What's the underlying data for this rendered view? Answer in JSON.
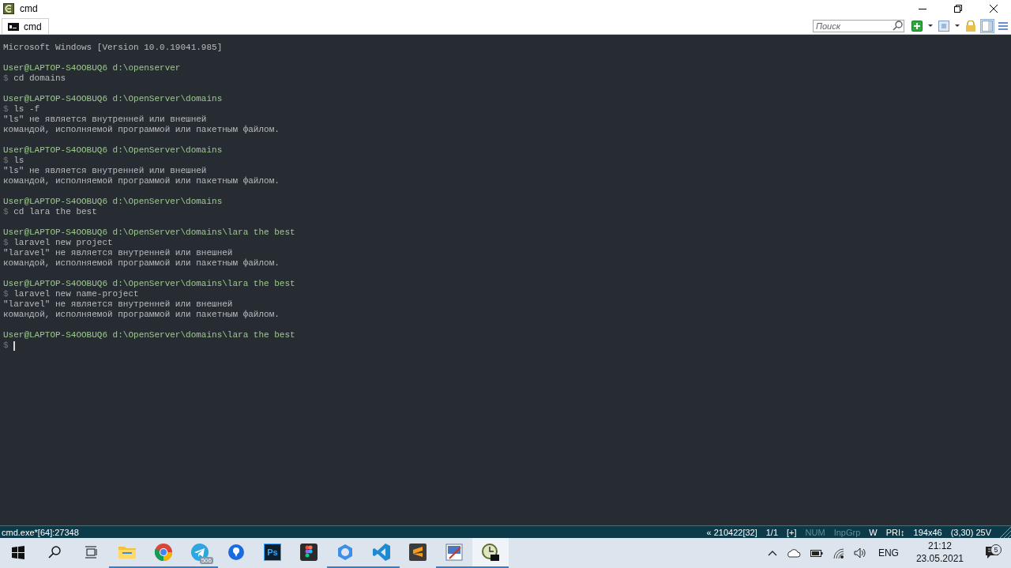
{
  "window": {
    "title": "cmd"
  },
  "tabs": [
    {
      "label": "cmd",
      "selected": true
    }
  ],
  "search": {
    "placeholder": "Поиск"
  },
  "toolbar": [
    {
      "kind": "add",
      "pressed": false
    },
    {
      "kind": "caret",
      "pressed": false
    },
    {
      "kind": "window",
      "pressed": false
    },
    {
      "kind": "caret",
      "pressed": false
    },
    {
      "kind": "lock",
      "pressed": false
    },
    {
      "kind": "panel",
      "pressed": true
    },
    {
      "kind": "menu",
      "pressed": false
    }
  ],
  "terminal": {
    "lines": [
      {
        "kind": "output",
        "text": "Microsoft Windows [Version 10.0.19041.985]"
      },
      {
        "kind": "blank"
      },
      {
        "kind": "prompt",
        "text": "User@LAPTOP-S4OOBUQ6 d:\\openserver"
      },
      {
        "kind": "command",
        "symbol": "$",
        "text": "cd domains"
      },
      {
        "kind": "blank"
      },
      {
        "kind": "prompt",
        "text": "User@LAPTOP-S4OOBUQ6 d:\\OpenServer\\domains"
      },
      {
        "kind": "command",
        "symbol": "$",
        "text": "ls -f"
      },
      {
        "kind": "output",
        "text": "\"ls\" не является внутренней или внешней"
      },
      {
        "kind": "output",
        "text": "командой, исполняемой программой или пакетным файлом."
      },
      {
        "kind": "blank"
      },
      {
        "kind": "prompt",
        "text": "User@LAPTOP-S4OOBUQ6 d:\\OpenServer\\domains"
      },
      {
        "kind": "command",
        "symbol": "$",
        "text": "ls"
      },
      {
        "kind": "output",
        "text": "\"ls\" не является внутренней или внешней"
      },
      {
        "kind": "output",
        "text": "командой, исполняемой программой или пакетным файлом."
      },
      {
        "kind": "blank"
      },
      {
        "kind": "prompt",
        "text": "User@LAPTOP-S4OOBUQ6 d:\\OpenServer\\domains"
      },
      {
        "kind": "command",
        "symbol": "$",
        "text": "cd lara the best"
      },
      {
        "kind": "blank"
      },
      {
        "kind": "prompt",
        "text": "User@LAPTOP-S4OOBUQ6 d:\\OpenServer\\domains\\lara the best"
      },
      {
        "kind": "command",
        "symbol": "$",
        "text": "laravel new project"
      },
      {
        "kind": "output",
        "text": "\"laravel\" не является внутренней или внешней"
      },
      {
        "kind": "output",
        "text": "командой, исполняемой программой или пакетным файлом."
      },
      {
        "kind": "blank"
      },
      {
        "kind": "prompt",
        "text": "User@LAPTOP-S4OOBUQ6 d:\\OpenServer\\domains\\lara the best"
      },
      {
        "kind": "command",
        "symbol": "$",
        "text": "laravel new name-project"
      },
      {
        "kind": "output",
        "text": "\"laravel\" не является внутренней или внешней"
      },
      {
        "kind": "output",
        "text": "командой, исполняемой программой или пакетным файлом."
      },
      {
        "kind": "blank"
      },
      {
        "kind": "prompt",
        "text": "User@LAPTOP-S4OOBUQ6 d:\\OpenServer\\domains\\lara the best"
      },
      {
        "kind": "input",
        "symbol": "$",
        "cursor": true
      }
    ]
  },
  "status_bar": {
    "process": "cmd.exe*[64]:27348",
    "items": [
      {
        "text": "« 210422[32]",
        "on": true
      },
      {
        "text": "1/1",
        "on": true
      },
      {
        "text": "[+]",
        "on": true
      },
      {
        "text": "NUM",
        "on": false
      },
      {
        "text": "InpGrp",
        "on": false
      },
      {
        "text": "W",
        "on": true
      },
      {
        "text": "PRI↕",
        "on": true
      },
      {
        "text": "194x46",
        "on": true
      },
      {
        "text": "(3,30) 25V",
        "on": true
      }
    ]
  },
  "taskbar": {
    "apps": [
      {
        "kind": "explorer",
        "running": true,
        "active": false
      },
      {
        "kind": "chrome",
        "running": true,
        "active": false
      },
      {
        "kind": "telegram",
        "running": true,
        "active": false,
        "badge": "506"
      },
      {
        "kind": "maps",
        "running": false,
        "active": false
      },
      {
        "kind": "photoshop",
        "running": false,
        "active": false,
        "label": "Ps"
      },
      {
        "kind": "figma",
        "running": false,
        "active": false
      },
      {
        "kind": "ring",
        "running": true,
        "active": false
      },
      {
        "kind": "vscode",
        "running": true,
        "active": false
      },
      {
        "kind": "sublime",
        "running": false,
        "active": false
      },
      {
        "kind": "paint",
        "running": true,
        "active": false
      },
      {
        "kind": "console",
        "running": true,
        "active": true
      }
    ],
    "tray": [
      {
        "kind": "chevron"
      },
      {
        "kind": "cloud"
      },
      {
        "kind": "battery"
      },
      {
        "kind": "wifi"
      },
      {
        "kind": "volume"
      }
    ],
    "language": "ENG",
    "time": "21:12",
    "date": "23.05.2021",
    "notifications": "5"
  }
}
